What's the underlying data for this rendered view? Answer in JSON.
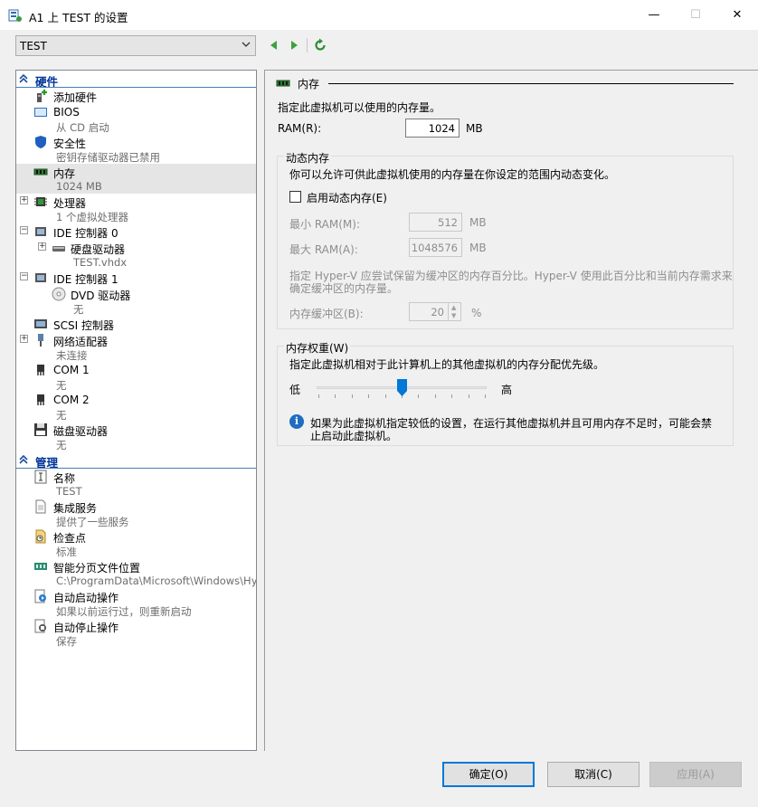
{
  "window": {
    "title": "A1 上 TEST 的设置",
    "minimize": "—",
    "maximize": "☐",
    "close": "✕"
  },
  "vm_selector": {
    "value": "TEST"
  },
  "tree": {
    "hardware_header": "硬件",
    "management_header": "管理",
    "items": [
      {
        "key": "add_hardware",
        "label": "添加硬件",
        "sub": ""
      },
      {
        "key": "bios",
        "label": "BIOS",
        "sub": "从 CD 启动"
      },
      {
        "key": "security",
        "label": "安全性",
        "sub": "密钥存储驱动器已禁用"
      },
      {
        "key": "memory",
        "label": "内存",
        "sub": "1024 MB"
      },
      {
        "key": "processor",
        "label": "处理器",
        "sub": "1 个虚拟处理器"
      },
      {
        "key": "ide0",
        "label": "IDE 控制器 0",
        "sub": ""
      },
      {
        "key": "hdd",
        "label": "硬盘驱动器",
        "sub": "TEST.vhdx"
      },
      {
        "key": "ide1",
        "label": "IDE 控制器 1",
        "sub": ""
      },
      {
        "key": "dvd",
        "label": "DVD 驱动器",
        "sub": "无"
      },
      {
        "key": "scsi",
        "label": "SCSI 控制器",
        "sub": ""
      },
      {
        "key": "nic",
        "label": "网络适配器",
        "sub": "未连接"
      },
      {
        "key": "com1",
        "label": "COM 1",
        "sub": "无"
      },
      {
        "key": "com2",
        "label": "COM 2",
        "sub": "无"
      },
      {
        "key": "floppy",
        "label": "磁盘驱动器",
        "sub": "无"
      }
    ],
    "mgmt_items": [
      {
        "key": "name",
        "label": "名称",
        "sub": "TEST"
      },
      {
        "key": "integration",
        "label": "集成服务",
        "sub": "提供了一些服务"
      },
      {
        "key": "checkpoints",
        "label": "检查点",
        "sub": "标准"
      },
      {
        "key": "paging",
        "label": "智能分页文件位置",
        "sub": "C:\\ProgramData\\Microsoft\\Windows\\Hyper-V"
      },
      {
        "key": "autostart",
        "label": "自动启动操作",
        "sub": "如果以前运行过，则重新启动"
      },
      {
        "key": "autostop",
        "label": "自动停止操作",
        "sub": "保存"
      }
    ]
  },
  "memory_panel": {
    "title": "内存",
    "desc": "指定此虚拟机可以使用的内存量。",
    "ram_label": "RAM(R):",
    "ram_value": "1024",
    "ram_unit": "MB",
    "dynamic": {
      "title": "动态内存",
      "desc": "你可以允许可供此虚拟机使用的内存量在你设定的范围内动态变化。",
      "enable_label": "启用动态内存(E)",
      "enabled": false,
      "min_label": "最小 RAM(M):",
      "min_value": "512",
      "max_label": "最大 RAM(A):",
      "max_value": "1048576",
      "unit": "MB",
      "buffer_desc_1": "指定 Hyper-V 应尝试保留为缓冲区的内存百分比。Hyper-V 使用此百分比和当前内存需求来",
      "buffer_desc_2": "确定缓冲区的内存量。",
      "buffer_label": "内存缓冲区(B):",
      "buffer_value": "20",
      "buffer_unit": "%"
    },
    "weight": {
      "title": "内存权重(W)",
      "desc": "指定此虚拟机相对于此计算机上的其他虚拟机的内存分配优先级。",
      "low": "低",
      "high": "高",
      "slider_fraction": 0.5,
      "info_1": "如果为此虚拟机指定较低的设置，在运行其他虚拟机并且可用内存不足时，可能会禁",
      "info_2": "止启动此虚拟机。"
    }
  },
  "buttons": {
    "ok": "确定(O)",
    "cancel": "取消(C)",
    "apply": "应用(A)"
  }
}
